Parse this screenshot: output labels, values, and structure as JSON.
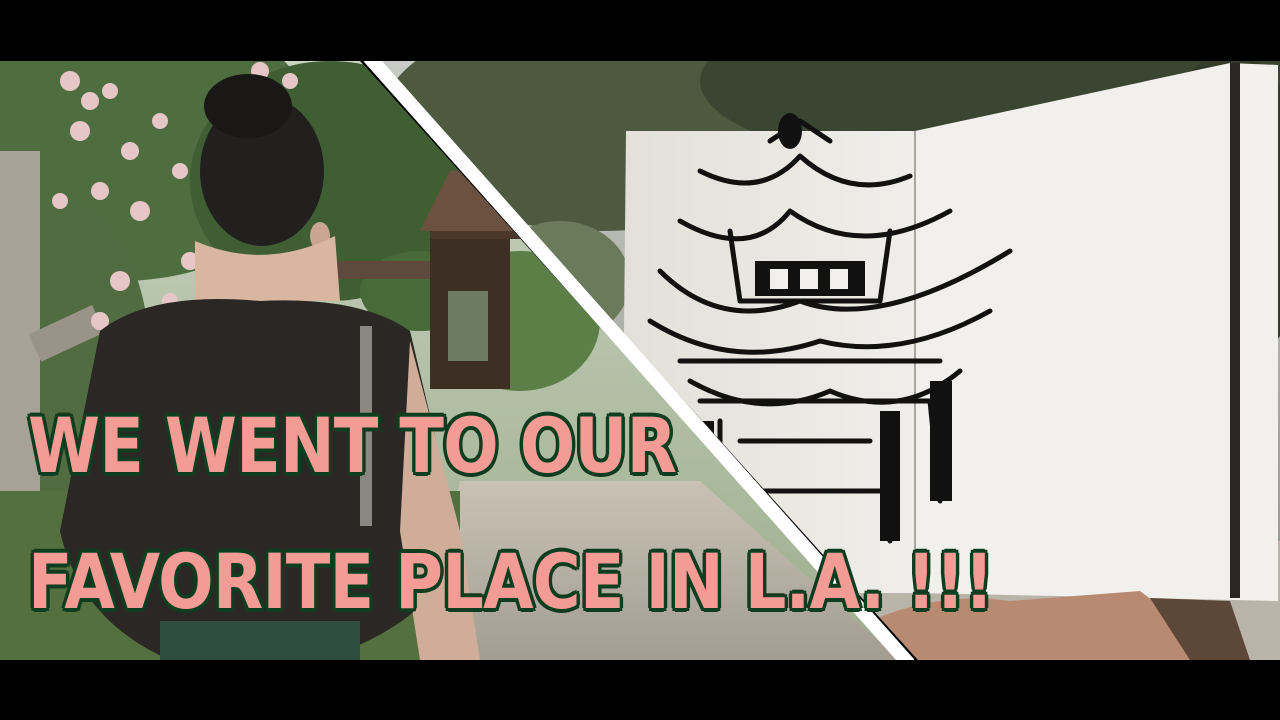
{
  "caption": {
    "line1": "WE WENT TO OUR",
    "line2": "FAVORITE PLACE IN L.A. !!!"
  },
  "colors": {
    "caption_fill": "#f39b95",
    "caption_outline": "#0f3d1f",
    "letterbox": "#000000",
    "divider": "#ffffff"
  },
  "scene": {
    "left_panel": "woman with hair bun walking on a garden path under rose bushes toward a wooden pavilion",
    "right_panel": "hand holding a sketchbook with an ink drawing of a Chinese pagoda, trees in background"
  }
}
